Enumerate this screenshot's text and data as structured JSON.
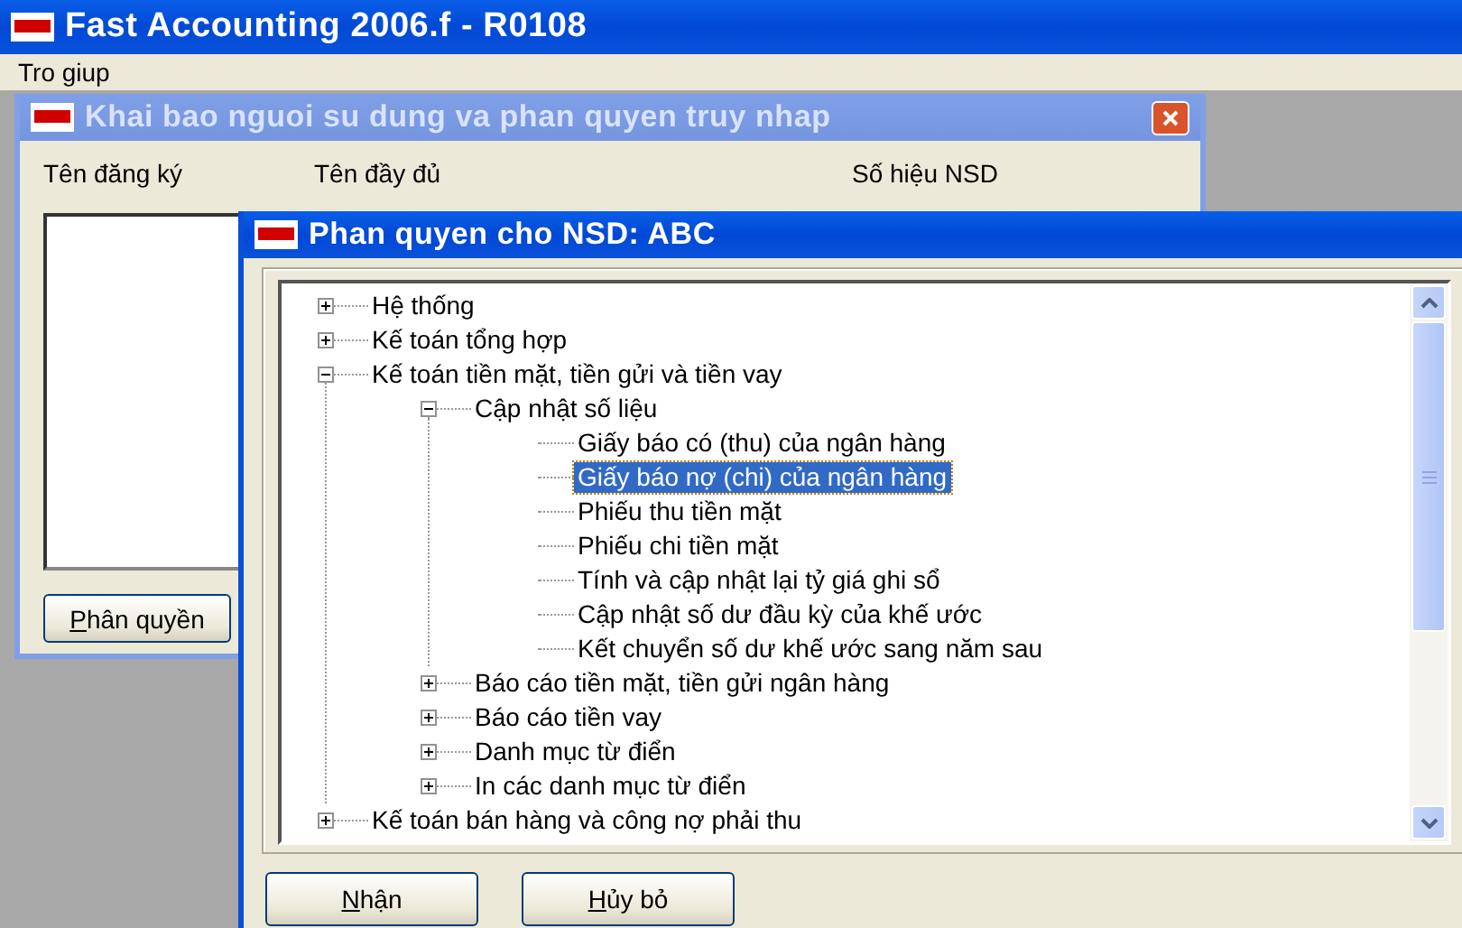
{
  "app": {
    "title": "Fast Accounting 2006.f - R0108",
    "menu": [
      "Tro giup"
    ]
  },
  "users_window": {
    "title": "Khai bao nguoi su dung va phan quyen truy nhap",
    "active": false,
    "columns": [
      "Tên đăng ký",
      "Tên đầy đủ",
      "Số hiệu NSD"
    ],
    "button": "Phân quyền"
  },
  "permissions_dialog": {
    "title": "Phan quyen cho NSD: ABC",
    "active": true,
    "tree": [
      {
        "label": "Hệ thống",
        "expanded": false,
        "selected": false
      },
      {
        "label": "Kế toán tổng hợp",
        "expanded": false,
        "selected": false
      },
      {
        "label": "Kế toán tiền mặt, tiền gửi và tiền vay",
        "expanded": true,
        "selected": false,
        "children": [
          {
            "label": "Cập nhật số liệu",
            "expanded": true,
            "selected": false,
            "children": [
              {
                "label": "Giấy báo có (thu) của ngân hàng",
                "selected": false
              },
              {
                "label": "Giấy báo nợ (chi) của ngân hàng",
                "selected": true
              },
              {
                "label": "Phiếu thu tiền mặt",
                "selected": false
              },
              {
                "label": "Phiếu chi tiền mặt",
                "selected": false
              },
              {
                "label": "Tính và cập nhật lại tỷ giá ghi sổ",
                "selected": false
              },
              {
                "label": "Cập nhật số dư đầu kỳ của khế ước",
                "selected": false
              },
              {
                "label": "Kết chuyển số dư khế ước sang năm sau",
                "selected": false
              }
            ]
          },
          {
            "label": "Báo cáo tiền mặt, tiền gửi ngân hàng",
            "expanded": false,
            "selected": false
          },
          {
            "label": "Báo cáo tiền vay",
            "expanded": false,
            "selected": false
          },
          {
            "label": "Danh mục từ điển",
            "expanded": false,
            "selected": false
          },
          {
            "label": "In các danh mục từ điển",
            "expanded": false,
            "selected": false
          }
        ]
      },
      {
        "label": "Kế toán bán hàng và công nợ phải thu",
        "expanded": false,
        "selected": false
      }
    ],
    "buttons": [
      "Nhận",
      "Hủy bỏ"
    ]
  }
}
